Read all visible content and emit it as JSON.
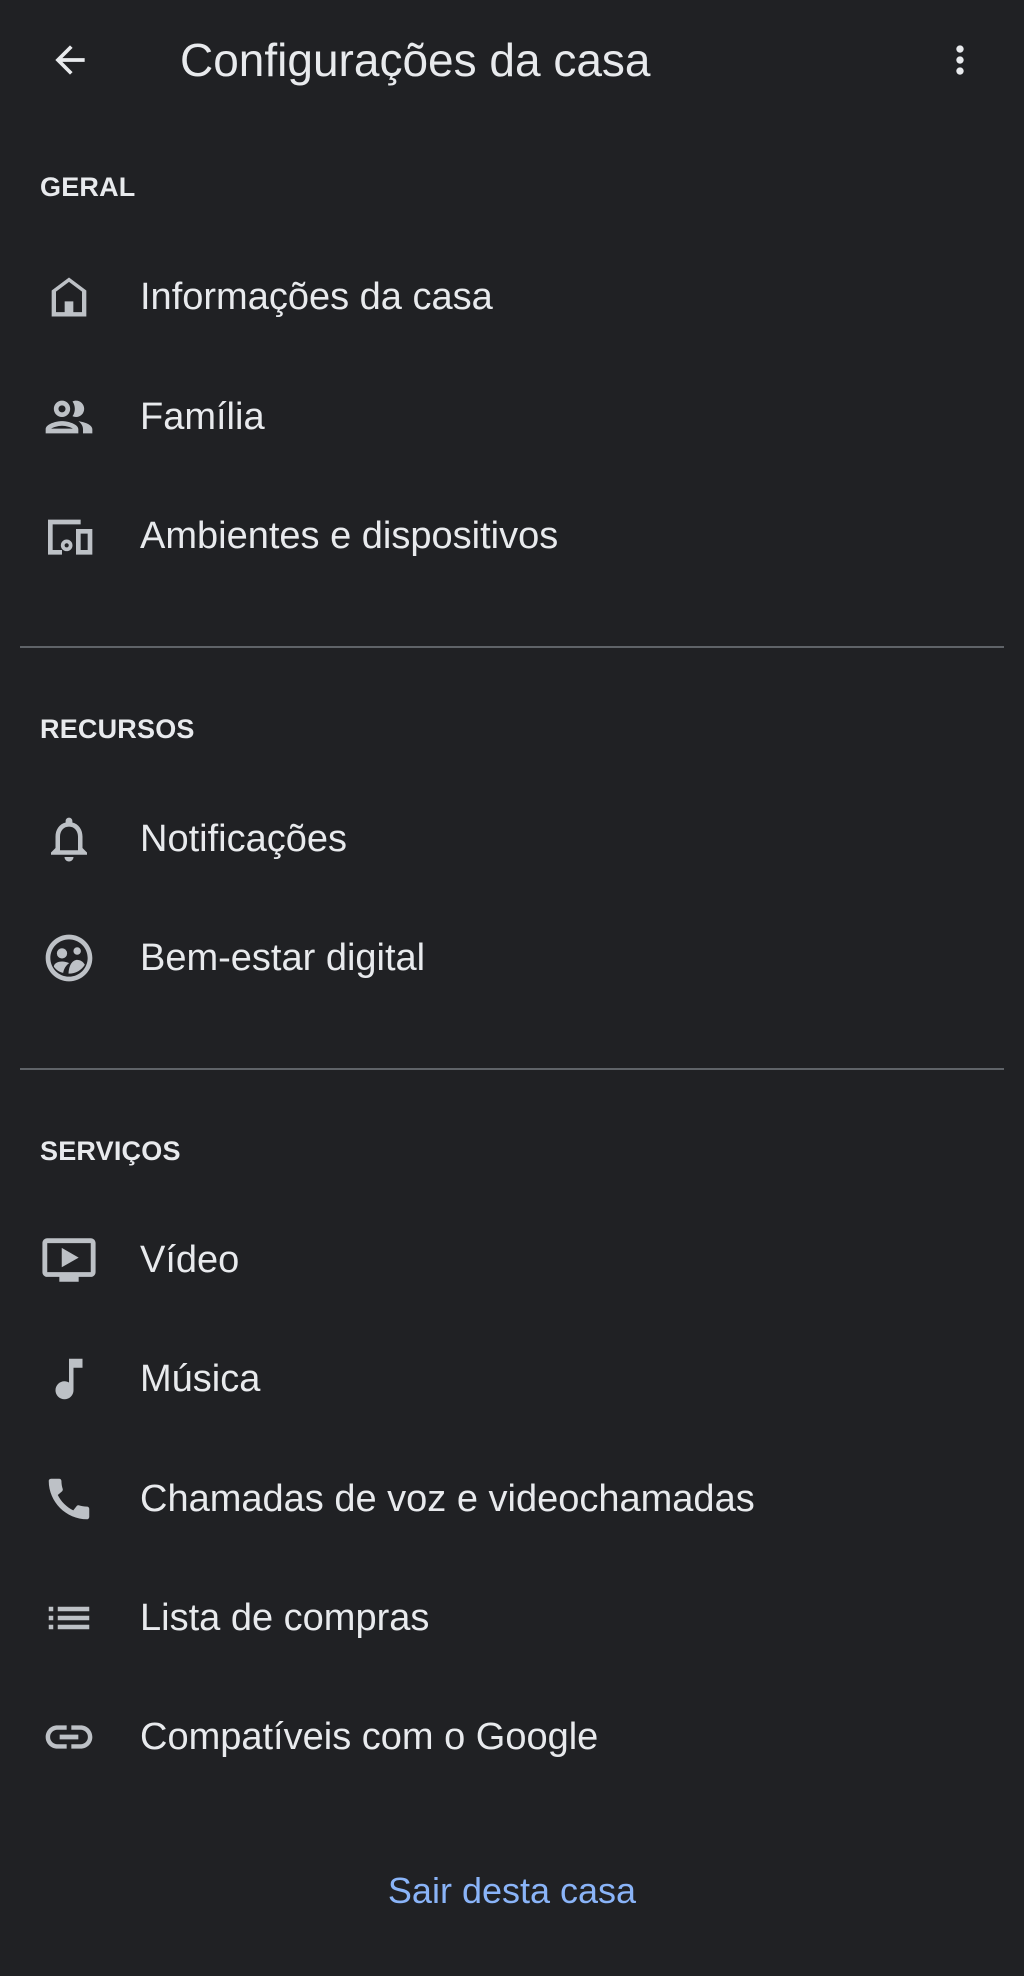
{
  "header": {
    "title": "Configurações da casa"
  },
  "sections": {
    "general": {
      "title": "GERAL",
      "items": [
        {
          "label": "Informações da casa",
          "icon": "home-icon"
        },
        {
          "label": "Família",
          "icon": "people-icon"
        },
        {
          "label": "Ambientes e dispositivos",
          "icon": "devices-icon"
        }
      ]
    },
    "features": {
      "title": "RECURSOS",
      "items": [
        {
          "label": "Notificações",
          "icon": "bell-icon"
        },
        {
          "label": "Bem-estar digital",
          "icon": "digital-wellbeing-icon"
        }
      ]
    },
    "services": {
      "title": "SERVIÇOS",
      "items": [
        {
          "label": "Vídeo",
          "icon": "video-icon"
        },
        {
          "label": "Música",
          "icon": "music-note-icon"
        },
        {
          "label": "Chamadas de voz e videochamadas",
          "icon": "phone-icon"
        },
        {
          "label": "Lista de compras",
          "icon": "list-icon"
        },
        {
          "label": "Compatíveis com o Google",
          "icon": "link-icon"
        }
      ]
    }
  },
  "footer": {
    "leave_label": "Sair desta casa"
  },
  "colors": {
    "background": "#202124",
    "text": "#e8eaed",
    "icon": "#bdc1c6",
    "accent": "#8ab4f8",
    "divider": "#5f6368"
  }
}
